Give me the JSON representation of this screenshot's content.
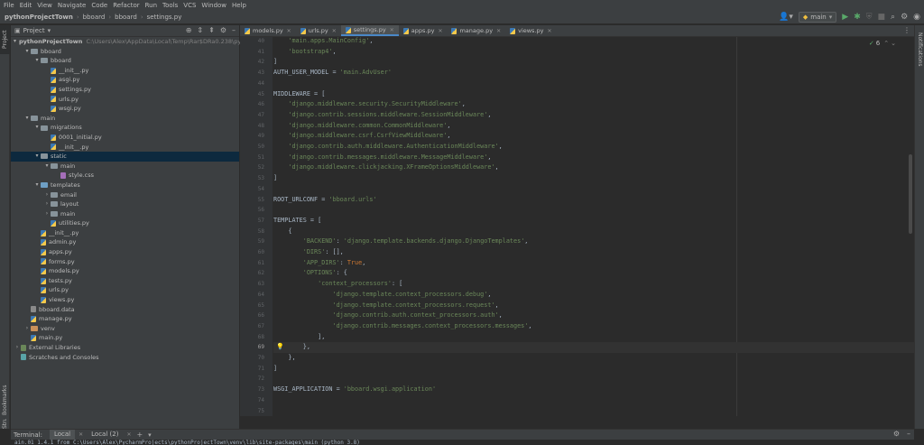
{
  "menu": [
    "File",
    "Edit",
    "View",
    "Navigate",
    "Code",
    "Refactor",
    "Run",
    "Tools",
    "VCS",
    "Window",
    "Help"
  ],
  "breadcrumb": [
    "pythonProjectTown",
    "bboard",
    "bboard",
    "settings.py"
  ],
  "run_config": "main",
  "left_tabs": {
    "project": "Project",
    "bookmarks": "Bookmarks",
    "structure": "Structure"
  },
  "right_tabs": {
    "notifications": "Notifications"
  },
  "project_panel": {
    "title": "Project",
    "tree": [
      {
        "depth": 0,
        "arrow": "▾",
        "icon": "folder",
        "label": "pythonProjectTown",
        "bold": true,
        "path": "C:\\Users\\Alex\\AppData\\Local\\Temp\\Rar$DRa0.238\\pythonP"
      },
      {
        "depth": 1,
        "arrow": "▾",
        "icon": "folder",
        "label": "bboard"
      },
      {
        "depth": 2,
        "arrow": "▾",
        "icon": "folder",
        "label": "bboard"
      },
      {
        "depth": 3,
        "arrow": "",
        "icon": "py",
        "label": "__init__.py"
      },
      {
        "depth": 3,
        "arrow": "",
        "icon": "py",
        "label": "asgi.py"
      },
      {
        "depth": 3,
        "arrow": "",
        "icon": "py",
        "label": "settings.py"
      },
      {
        "depth": 3,
        "arrow": "",
        "icon": "py",
        "label": "urls.py"
      },
      {
        "depth": 3,
        "arrow": "",
        "icon": "py",
        "label": "wsgi.py"
      },
      {
        "depth": 1,
        "arrow": "▾",
        "icon": "folder",
        "label": "main"
      },
      {
        "depth": 2,
        "arrow": "▾",
        "icon": "folder",
        "label": "migrations"
      },
      {
        "depth": 3,
        "arrow": "",
        "icon": "py",
        "label": "0001_initial.py"
      },
      {
        "depth": 3,
        "arrow": "",
        "icon": "py",
        "label": "__init__.py"
      },
      {
        "depth": 2,
        "arrow": "▾",
        "icon": "folder",
        "label": "static",
        "selected": true
      },
      {
        "depth": 3,
        "arrow": "▾",
        "icon": "folder",
        "label": "main"
      },
      {
        "depth": 4,
        "arrow": "",
        "icon": "css",
        "label": "style.css"
      },
      {
        "depth": 2,
        "arrow": "▾",
        "icon": "folder-blue",
        "label": "templates"
      },
      {
        "depth": 3,
        "arrow": "›",
        "icon": "folder",
        "label": "email"
      },
      {
        "depth": 3,
        "arrow": "›",
        "icon": "folder",
        "label": "layout"
      },
      {
        "depth": 3,
        "arrow": "›",
        "icon": "folder",
        "label": "main"
      },
      {
        "depth": 3,
        "arrow": "",
        "icon": "py",
        "label": "utilities.py"
      },
      {
        "depth": 2,
        "arrow": "",
        "icon": "py",
        "label": "__init__.py"
      },
      {
        "depth": 2,
        "arrow": "",
        "icon": "py",
        "label": "admin.py"
      },
      {
        "depth": 2,
        "arrow": "",
        "icon": "py",
        "label": "apps.py"
      },
      {
        "depth": 2,
        "arrow": "",
        "icon": "py",
        "label": "forms.py"
      },
      {
        "depth": 2,
        "arrow": "",
        "icon": "py",
        "label": "models.py"
      },
      {
        "depth": 2,
        "arrow": "",
        "icon": "py",
        "label": "tests.py"
      },
      {
        "depth": 2,
        "arrow": "",
        "icon": "py",
        "label": "urls.py"
      },
      {
        "depth": 2,
        "arrow": "",
        "icon": "py",
        "label": "views.py"
      },
      {
        "depth": 1,
        "arrow": "",
        "icon": "data",
        "label": "bboard.data"
      },
      {
        "depth": 1,
        "arrow": "",
        "icon": "py",
        "label": "manage.py"
      },
      {
        "depth": 1,
        "arrow": "›",
        "icon": "folder-excl",
        "label": "venv"
      },
      {
        "depth": 1,
        "arrow": "",
        "icon": "py",
        "label": "main.py"
      },
      {
        "depth": 0,
        "arrow": "›",
        "icon": "lib",
        "label": "External Libraries"
      },
      {
        "depth": 0,
        "arrow": "",
        "icon": "scr",
        "label": "Scratches and Consoles"
      }
    ]
  },
  "editor_tabs": [
    {
      "label": "models.py",
      "active": false
    },
    {
      "label": "urls.py",
      "active": false
    },
    {
      "label": "settings.py",
      "active": true
    },
    {
      "label": "apps.py",
      "active": false
    },
    {
      "label": "manage.py",
      "active": false
    },
    {
      "label": "views.py",
      "active": false
    }
  ],
  "editor": {
    "warnings_count": "6",
    "current_line": 69,
    "lines": [
      {
        "n": 40,
        "parts": [
          [
            "",
            "    "
          ],
          [
            "str",
            "'main.apps.MainConfig'"
          ],
          [
            "",
            ","
          ]
        ]
      },
      {
        "n": 41,
        "parts": [
          [
            "",
            "    "
          ],
          [
            "str",
            "'bootstrap4'"
          ],
          [
            "",
            ","
          ]
        ]
      },
      {
        "n": 42,
        "parts": [
          [
            "",
            "]"
          ]
        ]
      },
      {
        "n": 43,
        "parts": [
          [
            "",
            "AUTH_USER_MODEL = "
          ],
          [
            "str",
            "'main.AdvUser'"
          ]
        ]
      },
      {
        "n": 44,
        "parts": [
          [
            "",
            ""
          ]
        ]
      },
      {
        "n": 45,
        "parts": [
          [
            "",
            "MIDDLEWARE = ["
          ]
        ]
      },
      {
        "n": 46,
        "parts": [
          [
            "",
            "    "
          ],
          [
            "str",
            "'django.middleware.security.SecurityMiddleware'"
          ],
          [
            "",
            ","
          ]
        ]
      },
      {
        "n": 47,
        "parts": [
          [
            "",
            "    "
          ],
          [
            "str",
            "'django.contrib.sessions.middleware.SessionMiddleware'"
          ],
          [
            "",
            ","
          ]
        ]
      },
      {
        "n": 48,
        "parts": [
          [
            "",
            "    "
          ],
          [
            "str",
            "'django.middleware.common.CommonMiddleware'"
          ],
          [
            "",
            ","
          ]
        ]
      },
      {
        "n": 49,
        "parts": [
          [
            "",
            "    "
          ],
          [
            "str",
            "'django.middleware.csrf.CsrfViewMiddleware'"
          ],
          [
            "",
            ","
          ]
        ]
      },
      {
        "n": 50,
        "parts": [
          [
            "",
            "    "
          ],
          [
            "str",
            "'django.contrib.auth.middleware.AuthenticationMiddleware'"
          ],
          [
            "",
            ","
          ]
        ]
      },
      {
        "n": 51,
        "parts": [
          [
            "",
            "    "
          ],
          [
            "str",
            "'django.contrib.messages.middleware.MessageMiddleware'"
          ],
          [
            "",
            ","
          ]
        ]
      },
      {
        "n": 52,
        "parts": [
          [
            "",
            "    "
          ],
          [
            "str",
            "'django.middleware.clickjacking.XFrameOptionsMiddleware'"
          ],
          [
            "",
            ","
          ]
        ]
      },
      {
        "n": 53,
        "parts": [
          [
            "",
            "]"
          ]
        ]
      },
      {
        "n": 54,
        "parts": [
          [
            "",
            ""
          ]
        ]
      },
      {
        "n": 55,
        "parts": [
          [
            "",
            "ROOT_URLCONF = "
          ],
          [
            "str",
            "'bboard.urls'"
          ]
        ]
      },
      {
        "n": 56,
        "parts": [
          [
            "",
            ""
          ]
        ]
      },
      {
        "n": 57,
        "parts": [
          [
            "",
            "TEMPLATES = ["
          ]
        ]
      },
      {
        "n": 58,
        "parts": [
          [
            "",
            "    {"
          ]
        ]
      },
      {
        "n": 59,
        "parts": [
          [
            "",
            "        "
          ],
          [
            "str",
            "'BACKEND'"
          ],
          [
            "",
            ": "
          ],
          [
            "str",
            "'django.template.backends.django.DjangoTemplates'"
          ],
          [
            "",
            ","
          ]
        ]
      },
      {
        "n": 60,
        "parts": [
          [
            "",
            "        "
          ],
          [
            "str",
            "'DIRS'"
          ],
          [
            "",
            ": [],"
          ]
        ]
      },
      {
        "n": 61,
        "parts": [
          [
            "",
            "        "
          ],
          [
            "str",
            "'APP_DIRS'"
          ],
          [
            "",
            ": "
          ],
          [
            "kw",
            "True"
          ],
          [
            "",
            ","
          ]
        ]
      },
      {
        "n": 62,
        "parts": [
          [
            "",
            "        "
          ],
          [
            "str",
            "'OPTIONS'"
          ],
          [
            "",
            ": {"
          ]
        ]
      },
      {
        "n": 63,
        "parts": [
          [
            "",
            "            "
          ],
          [
            "str",
            "'context_processors'"
          ],
          [
            "",
            ": ["
          ]
        ]
      },
      {
        "n": 64,
        "parts": [
          [
            "",
            "                "
          ],
          [
            "str",
            "'django.template.context_processors.debug'"
          ],
          [
            "",
            ","
          ]
        ]
      },
      {
        "n": 65,
        "parts": [
          [
            "",
            "                "
          ],
          [
            "str",
            "'django.template.context_processors.request'"
          ],
          [
            "",
            ","
          ]
        ]
      },
      {
        "n": 66,
        "parts": [
          [
            "",
            "                "
          ],
          [
            "str",
            "'django.contrib.auth.context_processors.auth'"
          ],
          [
            "",
            ","
          ]
        ]
      },
      {
        "n": 67,
        "parts": [
          [
            "",
            "                "
          ],
          [
            "str",
            "'django.contrib.messages.context_processors.messages'"
          ],
          [
            "",
            ","
          ]
        ]
      },
      {
        "n": 68,
        "parts": [
          [
            "",
            "            ],"
          ]
        ]
      },
      {
        "n": 69,
        "parts": [
          [
            "",
            "        },"
          ]
        ]
      },
      {
        "n": 70,
        "parts": [
          [
            "",
            "    },"
          ]
        ]
      },
      {
        "n": 71,
        "parts": [
          [
            "",
            "]"
          ]
        ]
      },
      {
        "n": 72,
        "parts": [
          [
            "",
            ""
          ]
        ]
      },
      {
        "n": 73,
        "parts": [
          [
            "",
            "WSGI_APPLICATION = "
          ],
          [
            "str",
            "'bboard.wsgi.application'"
          ]
        ]
      },
      {
        "n": 74,
        "parts": [
          [
            "",
            ""
          ]
        ]
      },
      {
        "n": 75,
        "parts": [
          [
            "",
            ""
          ]
        ]
      }
    ]
  },
  "terminal": {
    "label": "Terminal:",
    "tabs": [
      {
        "label": "Local",
        "active": true
      },
      {
        "label": "Local (2)",
        "active": false
      }
    ],
    "output": "ain.01 1.4.1 from C:\\Users\\Alex\\PycharmProjects\\pythonProjectTown\\venv\\lib\\site-packages\\main (python 3.8)"
  },
  "colors": {
    "accent": "#4a88c7",
    "string": "#6a8759",
    "keyword": "#cc7832",
    "text": "#a9b7c6"
  }
}
